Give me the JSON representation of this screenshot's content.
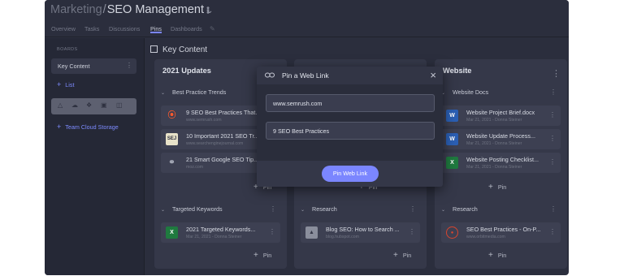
{
  "header": {
    "workspace": "Marketing",
    "separator": "/",
    "board": "SEO Management"
  },
  "tabs": [
    "Overview",
    "Tasks",
    "Discussions",
    "Pins",
    "Dashboards"
  ],
  "active_tab": "Pins",
  "sidebar": {
    "heading": "BOARDS",
    "items": [
      {
        "label": "Key Content"
      }
    ],
    "add_list_label": "List",
    "cloud_icons": [
      "google-drive-icon",
      "onedrive-icon",
      "dropbox-icon",
      "box-icon",
      "sharepoint-icon"
    ],
    "add_cloud_label": "Team Cloud Storage"
  },
  "main": {
    "title": "Key Content",
    "columns": [
      {
        "title": "2021 Updates",
        "groups": [
          {
            "title": "Best Practice Trends",
            "cards": [
              {
                "title": "9 SEO Best Practices That...",
                "subtitle": "www.semrush.com",
                "icon": "semrush-icon"
              },
              {
                "title": "10 Important 2021 SEO Tr...",
                "subtitle": "www.searchenginejournal.com",
                "icon": "sej-icon"
              },
              {
                "title": "21 Smart Google SEO Tip...",
                "subtitle": "moz.com",
                "icon": "link-icon"
              }
            ],
            "pin_label": "Pin"
          },
          {
            "title": "Targeted Keywords",
            "cards": [
              {
                "title": "2021 Targeted Keywords...",
                "subtitle": "Mar 21, 2021 - Donna Steiner",
                "icon": "excel-icon"
              }
            ],
            "pin_label": "Pin"
          }
        ]
      },
      {
        "title": "",
        "groups": [
          {
            "title": "",
            "cards": [],
            "pin_label": "Pin"
          },
          {
            "title": "Research",
            "cards": [
              {
                "title": "Blog SEO: How to Search ...",
                "subtitle": "blog.hubspot.com",
                "icon": "image-icon"
              }
            ],
            "pin_label": "Pin"
          }
        ]
      },
      {
        "title": "Website",
        "groups": [
          {
            "title": "Website Docs",
            "cards": [
              {
                "title": "Website Project Brief.docx",
                "subtitle": "Mar 21, 2021 - Donna Steiner",
                "icon": "word-icon"
              },
              {
                "title": "Website Update Process...",
                "subtitle": "Mar 21, 2021 - Donna Steiner",
                "icon": "word-icon"
              },
              {
                "title": "Website Posting Checklist...",
                "subtitle": "Mar 21, 2021 - Donna Steiner",
                "icon": "excel-icon"
              }
            ],
            "pin_label": "Pin"
          },
          {
            "title": "Research",
            "cards": [
              {
                "title": "SEO Best Practices - On-P...",
                "subtitle": "www.orbitmedia.com",
                "icon": "orbit-icon"
              }
            ],
            "pin_label": "Pin"
          }
        ]
      }
    ]
  },
  "modal": {
    "title": "Pin a Web Link",
    "url_value": "www.semrush.com",
    "name_value": "9 SEO Best Practices",
    "submit_label": "Pin Web Link"
  },
  "colors": {
    "accent": "#7b86ff",
    "background": "#2b2e3d",
    "column": "#353849",
    "card": "#3d4052",
    "modal": "#2a2d3b"
  }
}
